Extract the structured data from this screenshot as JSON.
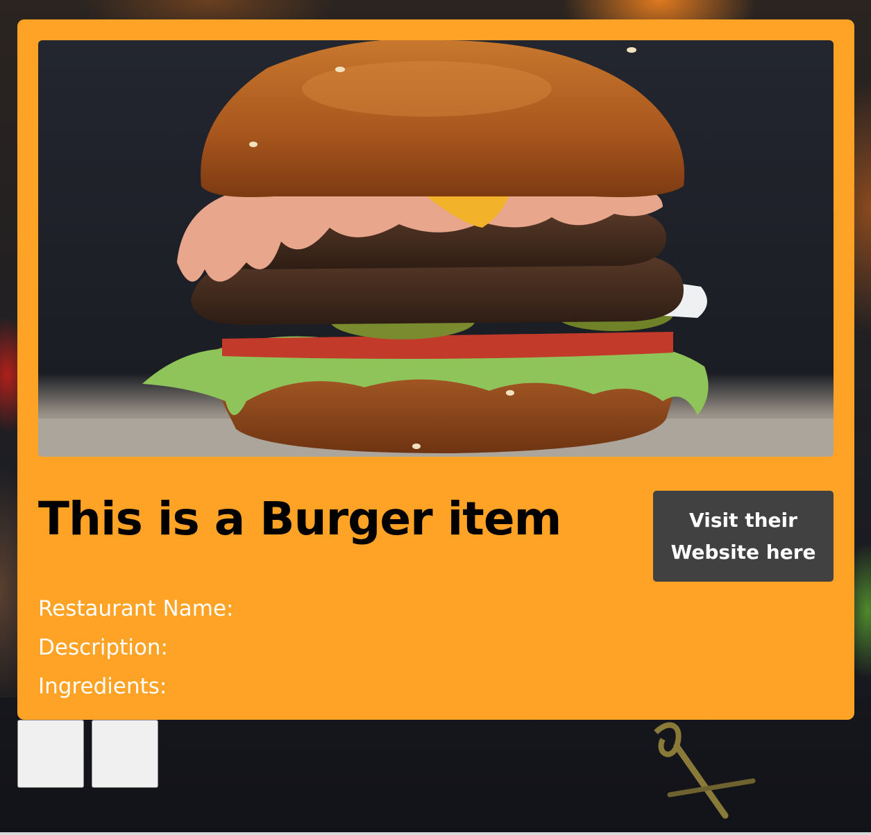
{
  "card": {
    "image_alt": "Burger photo",
    "title": "This is a Burger item",
    "visit_button": "Visit their Website here",
    "fields": {
      "restaurant_name_label": "Restaurant Name:",
      "description_label": "Description:",
      "ingredients_label": "Ingredients:"
    }
  },
  "colors": {
    "card_background": "#ffa326",
    "button_background": "#414141",
    "title_text": "#000000",
    "info_text": "#ffffff"
  },
  "controls": {
    "square_buttons": [
      "",
      ""
    ]
  }
}
